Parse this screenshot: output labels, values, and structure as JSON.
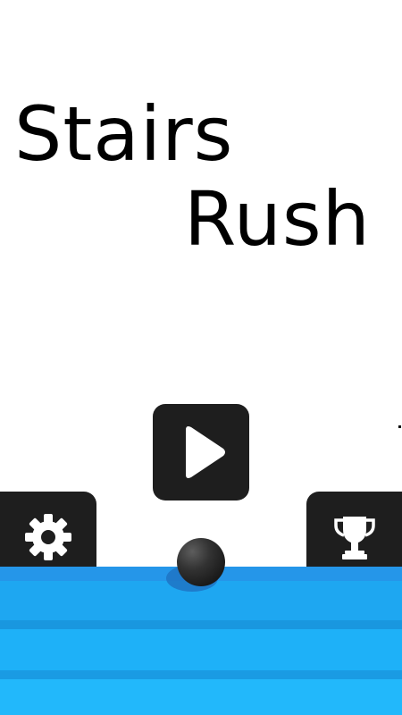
{
  "title": {
    "line1": "Stairs",
    "line2": "Rush"
  },
  "buttons": {
    "play": {
      "icon": "play-icon"
    },
    "settings": {
      "icon": "gear-icon"
    },
    "leaderboard": {
      "icon": "trophy-icon"
    }
  },
  "colors": {
    "background": "#ffffff",
    "title_text": "#000000",
    "button_bg": "#1e1e1e",
    "icon": "#ffffff",
    "stair_blue_top": "#2596e9",
    "stair_blue_light": "#1eb1f8",
    "ball": "#222222"
  }
}
